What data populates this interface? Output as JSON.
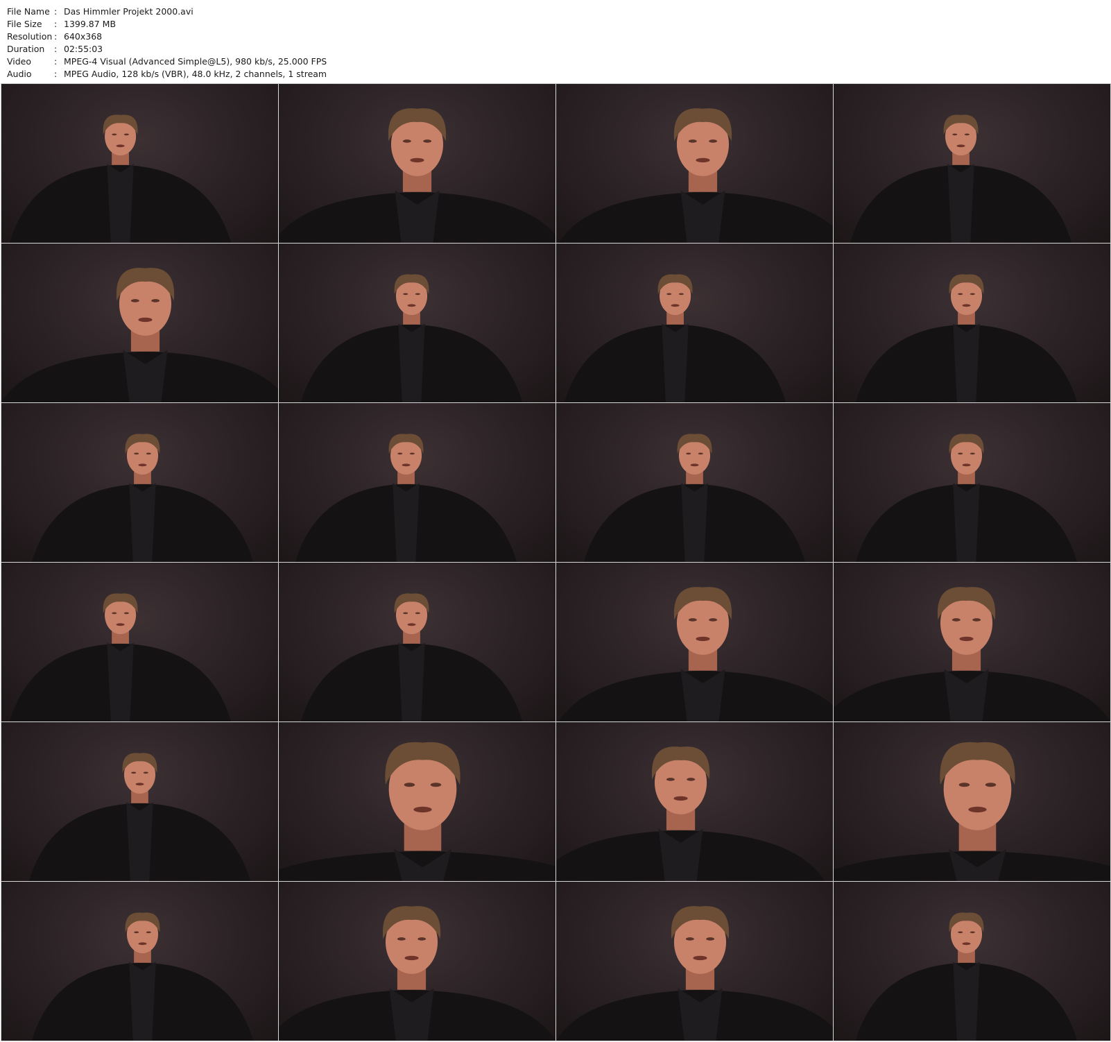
{
  "info": [
    {
      "label": "File Name",
      "sep": ":",
      "value": "Das Himmler Projekt 2000.avi"
    },
    {
      "label": "File Size",
      "sep": ":",
      "value": "1399.87 MB"
    },
    {
      "label": "Resolution",
      "sep": ":",
      "value": "640x368"
    },
    {
      "label": "Duration",
      "sep": ":",
      "value": "02:55:03"
    },
    {
      "label": "Video",
      "sep": ":",
      "value": "MPEG-4 Visual (Advanced Simple@L5), 980 kb/s, 25.000 FPS"
    },
    {
      "label": "Audio",
      "sep": ":",
      "value": "MPEG Audio, 128 kb/s (VBR), 48.0 kHz, 2 channels, 1 stream"
    }
  ],
  "colors": {
    "background": "#ffffff",
    "frame_backdrop": "#2a2124",
    "jacket": "#141213",
    "skin": "#c9826a",
    "hair": "#6b4e35"
  },
  "thumbnails": [
    {
      "icon": "frame-man-speaking"
    },
    {
      "icon": "frame-man-closeup"
    },
    {
      "icon": "frame-man-closeup"
    },
    {
      "icon": "frame-man-speaking"
    },
    {
      "icon": "frame-man-closeup"
    },
    {
      "icon": "frame-man-speaking"
    },
    {
      "icon": "frame-man-speaking"
    },
    {
      "icon": "frame-man-speaking"
    },
    {
      "icon": "frame-man-speaking"
    },
    {
      "icon": "frame-man-speaking"
    },
    {
      "icon": "frame-man-speaking"
    },
    {
      "icon": "frame-man-speaking"
    },
    {
      "icon": "frame-man-speaking"
    },
    {
      "icon": "frame-man-speaking"
    },
    {
      "icon": "frame-man-closeup"
    },
    {
      "icon": "frame-man-closeup"
    },
    {
      "icon": "frame-man-speaking"
    },
    {
      "icon": "frame-man-profile-closeup"
    },
    {
      "icon": "frame-man-closeup"
    },
    {
      "icon": "frame-man-profile-closeup"
    },
    {
      "icon": "frame-man-speaking"
    },
    {
      "icon": "frame-man-closeup"
    },
    {
      "icon": "frame-man-closeup"
    },
    {
      "icon": "frame-man-speaking"
    }
  ]
}
